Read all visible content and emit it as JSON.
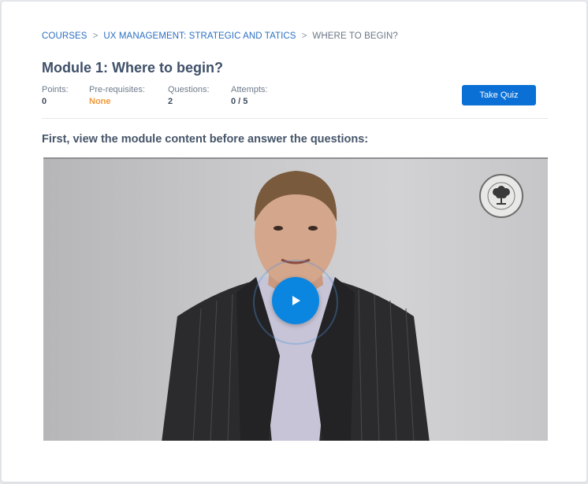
{
  "breadcrumb": {
    "items": [
      "COURSES",
      "UX MANAGEMENT: STRATEGIC AND TATICS"
    ],
    "separator": ">",
    "current": "WHERE TO BEGIN?"
  },
  "module": {
    "prefix": "Module 1:",
    "title": "Where to begin?"
  },
  "meta": {
    "points_label": "Points:",
    "points_value": "0",
    "prereq_label": "Pre-requisites:",
    "prereq_value": "None",
    "questions_label": "Questions:",
    "questions_value": "2",
    "attempts_label": "Attempts:",
    "attempts_value": "0 / 5"
  },
  "actions": {
    "take_quiz": "Take Quiz"
  },
  "content": {
    "instruction": "First, view the module content before answer the questions:"
  },
  "colors": {
    "accent": "#0a70d6",
    "play_button": "#0b86e0",
    "link": "#2a6fc1",
    "prereq_none": "#f0993a",
    "heading": "#3f5068"
  },
  "icons": {
    "play": "play-icon",
    "logo": "tree-logo-icon"
  }
}
